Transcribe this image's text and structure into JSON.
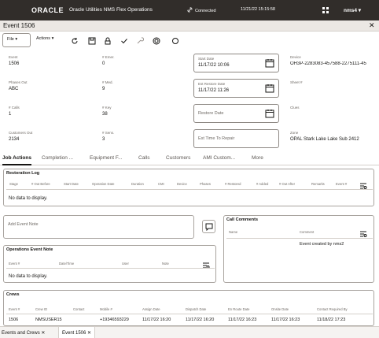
{
  "header": {
    "logo": "ORACLE",
    "app_title": "Oracle Utilities NMS Flex Operations",
    "connection": "Connected",
    "datetime": "11/21/22 15:15:58",
    "user": "nms4"
  },
  "window": {
    "title": "Event 1506"
  },
  "toolbar": {
    "file_label": "File",
    "actions_label": "Actions"
  },
  "fields": {
    "event_label": "Event",
    "event_value": "1506",
    "emer_label": "# Emer.",
    "emer_value": "0",
    "start_date_label": "Start Date",
    "start_date_value": "11/17/22 10:06",
    "device_label": "Device",
    "device_value": "OH3P-2283083-457588-2275111-45",
    "phases_label": "Phases Out",
    "phases_value": "ABC",
    "med_label": "# Med.",
    "med_value": "9",
    "est_restore_label": "Est Restore Date",
    "est_restore_value": "11/17/22 11:26",
    "sheet_label": "Sheet #",
    "calls_label": "# Calls",
    "calls_value": "1",
    "key_label": "# Key",
    "key_value": "38",
    "restore_date_placeholder": "Restore Date",
    "clues_label": "Clues",
    "cust_out_label": "Customers Out",
    "cust_out_value": "2134",
    "sens_label": "# Sens.",
    "sens_value": "3",
    "est_repair_placeholder": "Est Time To Repair",
    "zone_label": "Zone",
    "zone_value": "OPAL Stark Lake Lake Sub 2412"
  },
  "tabs": [
    "Job Actions",
    "Completion ...",
    "Equipment F...",
    "Calls",
    "Customers",
    "AMI Custom...",
    "More"
  ],
  "restoration_log": {
    "title": "Restoration Log",
    "columns": [
      "Stage",
      "# Out Before",
      "Start Date",
      "Operation Date",
      "Duration",
      "CMI",
      "Device",
      "Phases",
      "# Restored",
      "# Added",
      "# Out After",
      "Remarks",
      "Event #"
    ],
    "empty": "No data to display."
  },
  "add_event_note": {
    "placeholder": "Add Event Note"
  },
  "call_comments": {
    "title": "Call Comments",
    "columns": [
      "Name",
      "Comment"
    ],
    "rows": [
      {
        "name": "",
        "comment": "Event created by nms2"
      }
    ]
  },
  "operations_note": {
    "title": "Operations Event Note",
    "columns": [
      "Event #",
      "Date/Time",
      "User",
      "Note"
    ],
    "empty": "No data to display."
  },
  "crews": {
    "title": "Crews",
    "columns": [
      "Event #",
      "Crew ID",
      "Contact",
      "Mobile #",
      "Assign Date",
      "Dispatch Date",
      "En Route Date",
      "Onsite Date",
      "Contact Required By"
    ],
    "rows": [
      [
        "1506",
        "NMSUSER15",
        "",
        "+19346593229",
        "11/17/22 16:20",
        "11/17/22 16:20",
        "11/17/22 16:23",
        "11/17/22 16:23",
        "11/18/22 17:23"
      ]
    ]
  },
  "bottom_tabs": [
    {
      "label": "Events and Crews"
    },
    {
      "label": "Event 1506"
    }
  ],
  "colors": {
    "topbar": "#312d2a",
    "accent": "#161513"
  }
}
